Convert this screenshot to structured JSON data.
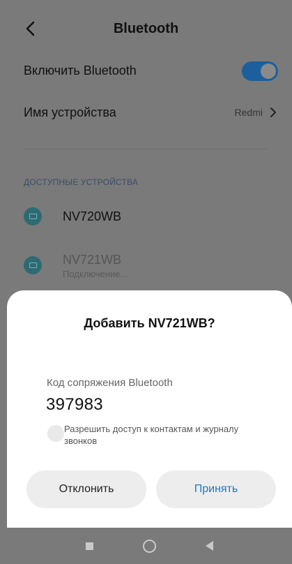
{
  "header": {
    "title": "Bluetooth",
    "back_icon": "chevron-left-icon"
  },
  "settings": {
    "enable_label": "Включить Bluetooth",
    "enable_on": true,
    "device_name_label": "Имя устройства",
    "device_name_value": "Redmi"
  },
  "available": {
    "section_title": "ДОСТУПНЫЕ УСТРОЙСТВА",
    "devices": [
      {
        "name": "NV720WB",
        "status": ""
      },
      {
        "name": "NV721WB",
        "status": "Подключение..."
      }
    ]
  },
  "dialog": {
    "title": "Добавить NV721WB?",
    "code_label": "Код сопряжения Bluetooth",
    "code_value": "397983",
    "checkbox_label": "Разрешить доступ к контактам и журналу звонков",
    "checkbox_checked": false,
    "decline_label": "Отклонить",
    "accept_label": "Принять",
    "accent_color": "#1f78c4"
  },
  "navbar": {
    "icons": [
      "recents-square-icon",
      "home-circle-icon",
      "back-triangle-icon"
    ]
  }
}
